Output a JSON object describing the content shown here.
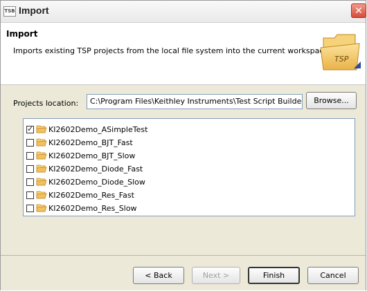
{
  "window": {
    "title": "Import",
    "app_icon_text": "TSB"
  },
  "banner": {
    "title": "Import",
    "description": "Imports existing TSP projects from the local file system into the current workspace",
    "graphic_label": "TSP"
  },
  "location": {
    "label": "Projects location:",
    "value": "C:\\Program Files\\Keithley Instruments\\Test Script Builder\\",
    "browse_label": "Browse..."
  },
  "projects": [
    {
      "name": "KI2602Demo_ASimpleTest",
      "checked": true
    },
    {
      "name": "KI2602Demo_BJT_Fast",
      "checked": false
    },
    {
      "name": "KI2602Demo_BJT_Slow",
      "checked": false
    },
    {
      "name": "KI2602Demo_Diode_Fast",
      "checked": false
    },
    {
      "name": "KI2602Demo_Diode_Slow",
      "checked": false
    },
    {
      "name": "KI2602Demo_Res_Fast",
      "checked": false
    },
    {
      "name": "KI2602Demo_Res_Slow",
      "checked": false
    }
  ],
  "buttons": {
    "back": "< Back",
    "next": "Next >",
    "finish": "Finish",
    "cancel": "Cancel"
  },
  "icons": {
    "folder": "folder-icon",
    "close": "close-icon"
  },
  "colors": {
    "folder": "#f2c060",
    "close": "#d9493a"
  }
}
